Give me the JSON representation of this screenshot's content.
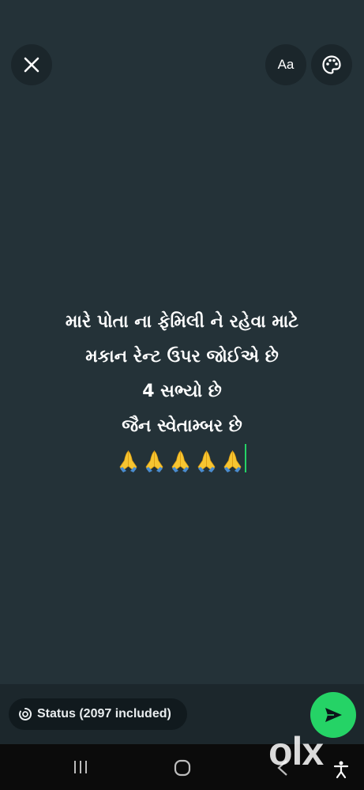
{
  "toolbar": {
    "close_icon": "close-icon",
    "font_button_label": "Aa",
    "palette_icon": "palette-icon"
  },
  "status_message": {
    "lines": [
      "મારે પોતા ના ફેમિલી ને રહેવા માટે",
      "મકાન રેન્ટ ઉપર જોઈએ છે",
      "4 સભ્યો છે",
      "જૈન સ્વેતામ્બર છે"
    ],
    "emoji": "🙏🙏🙏🙏🙏",
    "emoji_count": 5
  },
  "footer": {
    "status_audience_label": "Status (2097 included)",
    "status_audience_icon": "status-ring-icon",
    "send_icon": "send-icon"
  },
  "watermark": "olx",
  "colors": {
    "background": "#243238",
    "accent": "#25d366"
  }
}
